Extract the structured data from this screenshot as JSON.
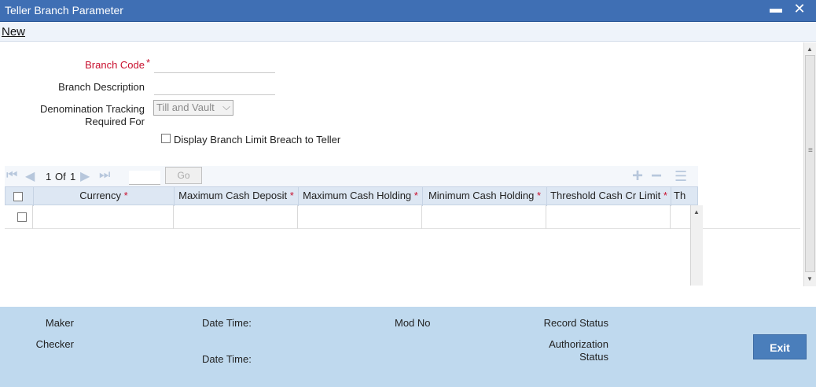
{
  "window": {
    "title": "Teller Branch Parameter",
    "minimize": "▬",
    "close": "✕"
  },
  "toolbar": {
    "new_label": "New"
  },
  "form": {
    "branch_code_label": "Branch Code",
    "branch_code_value": "",
    "branch_description_label": "Branch Description",
    "branch_description_value": "",
    "denomination_label_line1": "Denomination Tracking",
    "denomination_label_line2": "Required For",
    "denomination_value": "Till and Vault",
    "display_breach_label": "Display Branch Limit Breach to Teller",
    "display_breach_checked": false,
    "required_marker": "*"
  },
  "pager": {
    "current": "1",
    "of_label": "Of",
    "total": "1",
    "go_label": "Go"
  },
  "grid": {
    "columns": [
      {
        "label": "Currency",
        "required": true
      },
      {
        "label": "Maximum Cash Deposit",
        "required": true
      },
      {
        "label": "Maximum Cash Holding",
        "required": true
      },
      {
        "label": "Minimum Cash Holding",
        "required": true
      },
      {
        "label": "Threshold Cash Cr Limit",
        "required": true
      },
      {
        "label": "Th",
        "required": false
      }
    ],
    "rows": [
      {
        "cells": [
          "",
          "",
          "",
          "",
          "",
          ""
        ]
      }
    ]
  },
  "footer": {
    "maker_label": "Maker",
    "checker_label": "Checker",
    "date_time_label": "Date Time:",
    "date_time_label_2": "Date Time:",
    "mod_no_label": "Mod No",
    "record_status_label": "Record Status",
    "authorization_status_line1": "Authorization",
    "authorization_status_line2": "Status",
    "exit_label": "Exit"
  },
  "colors": {
    "title_bar": "#3f6fb4",
    "footer": "#bfd9ee",
    "exit_button": "#4a7ebb",
    "required": "#c8102e"
  }
}
